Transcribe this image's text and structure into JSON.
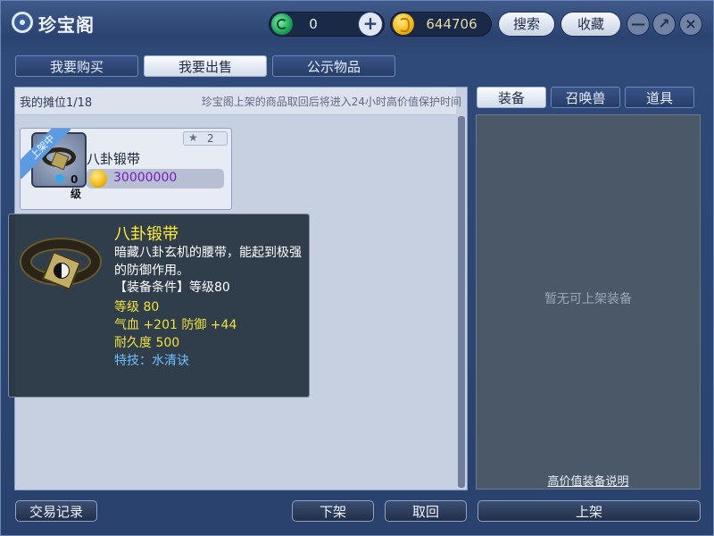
{
  "window": {
    "title": "珍宝阁"
  },
  "currency": {
    "jade": "0",
    "gold": "644706"
  },
  "toolbar": {
    "search_label": "搜索",
    "favorites_label": "收藏",
    "minimize": "—",
    "maximize": "↗",
    "close": "×",
    "add": "+"
  },
  "tabs": [
    {
      "label": "我要购买",
      "active": false
    },
    {
      "label": "我要出售",
      "active": true
    },
    {
      "label": "公示物品",
      "active": false
    }
  ],
  "stall": {
    "label": "我的摊位1/18",
    "notice": "珍宝阁上架的商品取回后将进入24小时高价值保护时间"
  },
  "item": {
    "status": "上架中",
    "name": "八卦锻带",
    "level_badge": "0级",
    "star_count": "2",
    "price": "30000000"
  },
  "tooltip": {
    "name": "八卦锻带",
    "description": "暗藏八卦玄机的腰带，能起到极强的防御作用。",
    "requirement": "【装备条件】等级80",
    "level": "等级 80",
    "stats": "气血 +201 防御 +44",
    "durability": "耐久度 500",
    "skill": "特技：水清诀"
  },
  "right_tabs": [
    {
      "label": "装备",
      "active": true
    },
    {
      "label": "召唤兽",
      "active": false
    },
    {
      "label": "道具",
      "active": false
    }
  ],
  "right_panel": {
    "empty_text": "暂无可上架装备",
    "link_text": "高价值装备说明"
  },
  "bottom": {
    "records_label": "交易记录",
    "delist_label": "下架",
    "retrieve_label": "取回",
    "list_label": "上架"
  },
  "colors": {
    "price": "#7a19c7",
    "tooltip_title": "#ffee33",
    "tooltip_stat": "#f0e23c",
    "tooltip_skill": "#6fc0ff"
  }
}
